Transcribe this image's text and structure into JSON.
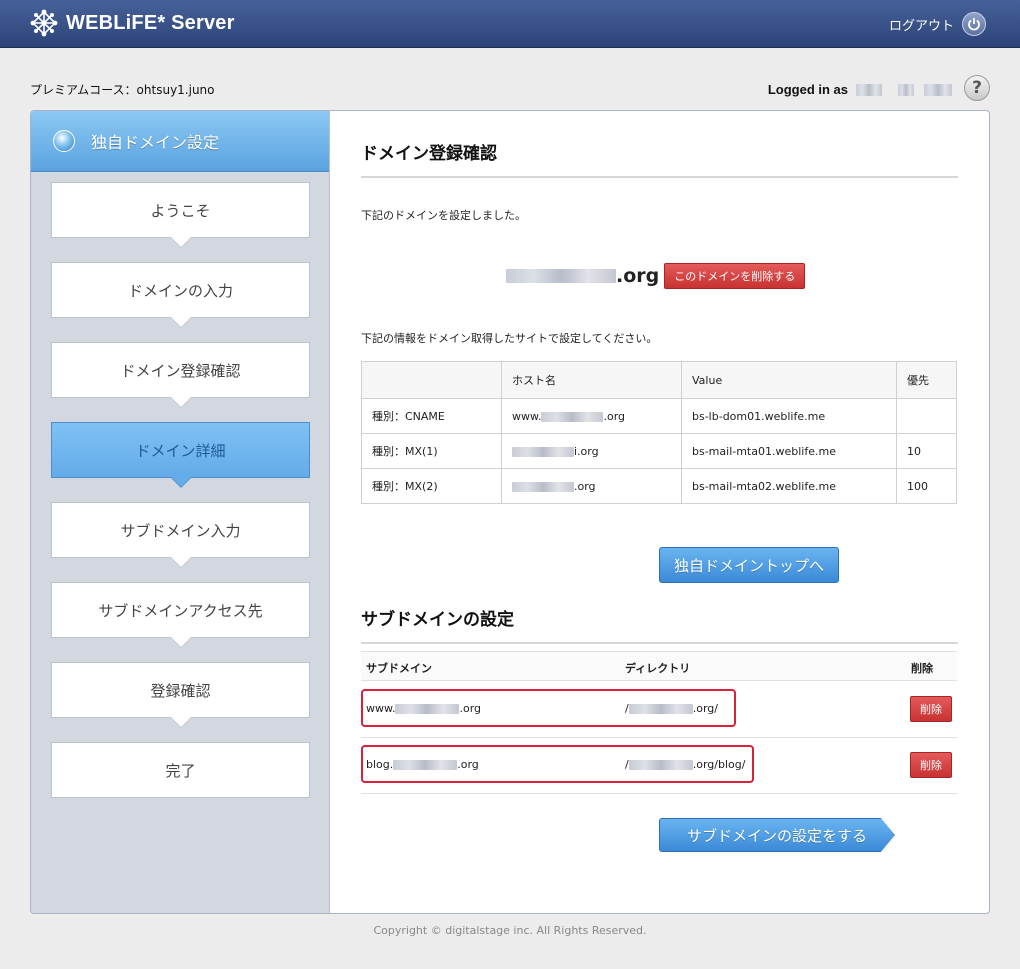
{
  "header": {
    "app_title": "WEBLiFE* Server",
    "logout_label": "ログアウト"
  },
  "account": {
    "course": "プレミアムコース：ohtsuy1.juno",
    "logged_in_label": "Logged in as"
  },
  "help_label": "?",
  "sidebar": {
    "title": "独自ドメイン設定",
    "steps": [
      {
        "label": "ようこそ"
      },
      {
        "label": "ドメインの入力"
      },
      {
        "label": "ドメイン登録確認"
      },
      {
        "label": "ドメイン詳細",
        "active": true
      },
      {
        "label": "サブドメイン入力"
      },
      {
        "label": "サブドメインアクセス先"
      },
      {
        "label": "登録確認"
      },
      {
        "label": "完了"
      }
    ]
  },
  "main": {
    "heading": "ドメイン登録確認",
    "intro": "下記のドメインを設定しました。",
    "domain_suffix": ".org",
    "delete_domain_button": "このドメインを削除する",
    "instruction": "下記の情報をドメイン取得したサイトで設定してください。",
    "dns_table": {
      "headers": [
        "",
        "ホスト名",
        "Value",
        "優先"
      ],
      "rows": [
        {
          "type": "種別：CNAME",
          "host_prefix": "www.",
          "host_suffix": ".org",
          "value": "bs-lb-dom01.weblife.me",
          "priority": ""
        },
        {
          "type": "種別：MX(1)",
          "host_prefix": "",
          "host_suffix": "i.org",
          "value": "bs-mail-mta01.weblife.me",
          "priority": "10"
        },
        {
          "type": "種別：MX(2)",
          "host_prefix": "",
          "host_suffix": ".org",
          "value": "bs-mail-mta02.weblife.me",
          "priority": "100"
        }
      ]
    },
    "top_button": "独自ドメイントップへ"
  },
  "subdomain": {
    "heading": "サブドメインの設定",
    "headers": {
      "name": "サブドメイン",
      "dir": "ディレクトリ",
      "del": "削除"
    },
    "rows": [
      {
        "name_prefix": "www.",
        "name_suffix": ".org",
        "dir_prefix": "/",
        "dir_suffix": ".org/",
        "delete": "削除"
      },
      {
        "name_prefix": "blog.",
        "name_suffix": ".org",
        "dir_prefix": "/",
        "dir_suffix": ".org/blog/",
        "delete": "削除"
      }
    ],
    "submit_button": "サブドメインの設定をする"
  },
  "footer": {
    "copyright": "Copyright © digitalstage inc. All Rights Reserved."
  },
  "colors": {
    "header_bg": "#2c4478",
    "accent_blue": "#3b8ad8",
    "delete_red": "#c83232",
    "highlight_red": "#d9213a"
  }
}
